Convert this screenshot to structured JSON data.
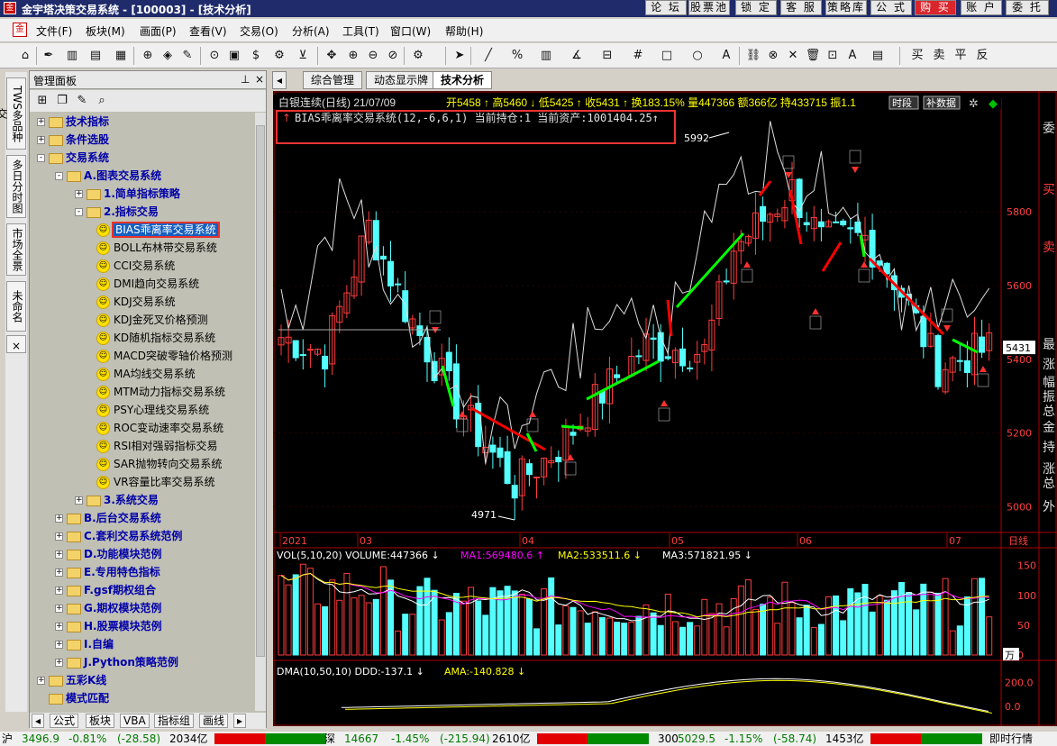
{
  "window": {
    "title": "金宇塔决策交易系统 - [100003] - [技术分析]",
    "top_buttons": [
      "论 坛",
      "股票池",
      "锁 定",
      "客 服",
      "策略库",
      "公 式",
      "购 买",
      "账 户",
      "委 托"
    ]
  },
  "menu": {
    "items": [
      "文件(F)",
      "板块(M)",
      "画面(P)",
      "查看(V)",
      "交易(O)",
      "分析(A)",
      "工具(T)",
      "窗口(W)",
      "帮助(H)"
    ]
  },
  "side_tabs": [
    "TWS多品种交",
    "多日分时图",
    "市场全景",
    "未命名"
  ],
  "side_tab_close": "×",
  "panel": {
    "title": "管理面板",
    "tree": [
      {
        "label": "技术指标",
        "level": 0,
        "type": "folder",
        "exp": "+"
      },
      {
        "label": "条件选股",
        "level": 0,
        "type": "folder",
        "exp": "+"
      },
      {
        "label": "交易系统",
        "level": 0,
        "type": "folder",
        "exp": "-"
      },
      {
        "label": "A.图表交易系统",
        "level": 1,
        "type": "folder",
        "exp": "-"
      },
      {
        "label": "1.简单指标策略",
        "level": 2,
        "type": "folder",
        "exp": "+"
      },
      {
        "label": "2.指标交易",
        "level": 2,
        "type": "folder",
        "exp": "-"
      },
      {
        "label": "BIAS乖离率交易系统",
        "level": 3,
        "type": "leaf",
        "selected": true
      },
      {
        "label": "BOLL布林带交易系统",
        "level": 3,
        "type": "leaf"
      },
      {
        "label": "CCI交易系统",
        "level": 3,
        "type": "leaf"
      },
      {
        "label": "DMI趋向交易系统",
        "level": 3,
        "type": "leaf"
      },
      {
        "label": "KDJ交易系统",
        "level": 3,
        "type": "leaf"
      },
      {
        "label": "KDJ金死叉价格预测",
        "level": 3,
        "type": "leaf"
      },
      {
        "label": "KD随机指标交易系统",
        "level": 3,
        "type": "leaf"
      },
      {
        "label": "MACD突破零轴价格预测",
        "level": 3,
        "type": "leaf"
      },
      {
        "label": "MA均线交易系统",
        "level": 3,
        "type": "leaf"
      },
      {
        "label": "MTM动力指标交易系统",
        "level": 3,
        "type": "leaf"
      },
      {
        "label": "PSY心理线交易系统",
        "level": 3,
        "type": "leaf"
      },
      {
        "label": "ROC变动速率交易系统",
        "level": 3,
        "type": "leaf"
      },
      {
        "label": "RSI相对强弱指标交易",
        "level": 3,
        "type": "leaf"
      },
      {
        "label": "SAR抛物转向交易系统",
        "level": 3,
        "type": "leaf"
      },
      {
        "label": "VR容量比率交易系统",
        "level": 3,
        "type": "leaf"
      },
      {
        "label": "3.系统交易",
        "level": 2,
        "type": "folder",
        "exp": "+"
      },
      {
        "label": "B.后台交易系统",
        "level": 1,
        "type": "folder",
        "exp": "+"
      },
      {
        "label": "C.套利交易系统范例",
        "level": 1,
        "type": "folder",
        "exp": "+"
      },
      {
        "label": "D.功能模块范例",
        "level": 1,
        "type": "folder",
        "exp": "+"
      },
      {
        "label": "E.专用特色指标",
        "level": 1,
        "type": "folder",
        "exp": "+"
      },
      {
        "label": "F.gsf期权组合",
        "level": 1,
        "type": "folder",
        "exp": "+"
      },
      {
        "label": "G.期权模块范例",
        "level": 1,
        "type": "folder",
        "exp": "+"
      },
      {
        "label": "H.股票模块范例",
        "level": 1,
        "type": "folder",
        "exp": "+"
      },
      {
        "label": "I.自编",
        "level": 1,
        "type": "folder",
        "exp": "+"
      },
      {
        "label": "J.Python策略范例",
        "level": 1,
        "type": "folder",
        "exp": "+"
      },
      {
        "label": "五彩K线",
        "level": 0,
        "type": "folder",
        "exp": "+"
      },
      {
        "label": "模式匹配",
        "level": 0,
        "type": "folder",
        "exp": ""
      }
    ],
    "bottom_tabs": [
      "公式",
      "板块",
      "VBA",
      "指标组",
      "画线",
      "▸"
    ]
  },
  "window_tabs": [
    "综合管理",
    "动态显示牌",
    "技术分析"
  ],
  "chart": {
    "header_text": "白银连续(日线) 21/07/09",
    "header_quote": "开5458 ↑ 高5460 ↓ 低5425 ↑ 收5431 ↑ 换183.15% 量447366 额366亿 持433715 振1.1",
    "header_buttons": [
      "时段",
      "补数据"
    ],
    "system_line": "BIAS乖离率交易系统(12,-6,6,1)  当前持仓:1  当前资产:1001404.25↑",
    "price_high": "5992",
    "price_low": "4971",
    "price_axis": [
      "5800",
      "5600",
      "5400",
      "5200",
      "5000"
    ],
    "current_price": "5431",
    "date_labels": [
      "2021",
      "03",
      "04",
      "05",
      "06",
      "07"
    ],
    "date_axis_label": "日线",
    "vol_header": [
      "VOL(5,10,20)  VOLUME:447366 ↓",
      "MA1:569480.6 ↑",
      "MA2:533511.6 ↓",
      "MA3:571821.95 ↓"
    ],
    "vol_axis": [
      "150",
      "100",
      "50",
      "0"
    ],
    "vol_unit": "万",
    "dma_header": [
      "DMA(10,50,10)  DDD:-137.1 ↓",
      "AMA:-140.828 ↓"
    ],
    "dma_axis": [
      "200.0",
      "0.0"
    ],
    "right_labels": [
      "委",
      "买",
      "卖",
      "最",
      "涨",
      "幅",
      "振",
      "总",
      "金",
      "持",
      "涨",
      "总",
      "外"
    ],
    "colors": {
      "up": "#ff3c3c",
      "down": "#54ffff",
      "buy": "#00ff00",
      "sell": "#ff0000",
      "ma1": "#ffffff",
      "ma2": "#ff00ff",
      "ma3": "#ffff00"
    }
  },
  "status": {
    "items": [
      {
        "name": "沪",
        "value": "3496.9",
        "chg": "-0.81%",
        "pt": "(-28.58)",
        "amt": "2034亿"
      },
      {
        "name": "深",
        "value": "14667",
        "chg": "-1.45%",
        "pt": "(-215.94)",
        "amt": "2610亿"
      },
      {
        "name": "300",
        "value": "5029.5",
        "chg": "-1.15%",
        "pt": "(-58.74)",
        "amt": "1453亿"
      }
    ],
    "right_text": "即时行情"
  }
}
